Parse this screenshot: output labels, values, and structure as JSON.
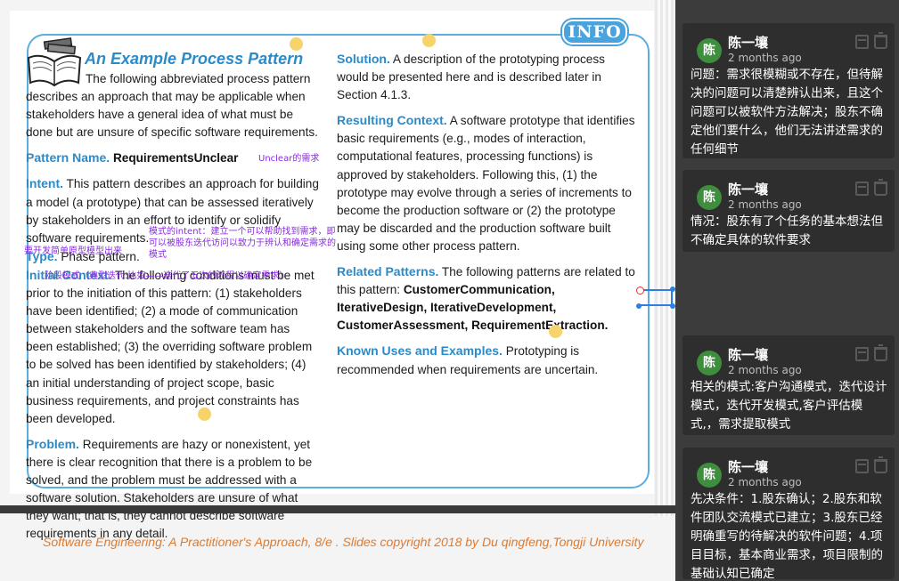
{
  "slide": {
    "info_badge": "INFO",
    "title": "An Example Process Pattern",
    "intro": "The following abbreviated process pattern describes an approach that may be applicable when stakeholders have a general idea of what must be done but are unsure of specific software requirements.",
    "pattern_name_label": "Pattern Name.",
    "pattern_name_value": "RequirementsUnclear",
    "intent_label": "Intent.",
    "intent_text": "This pattern describes an approach for building a model (a prototype) that can be assessed iteratively by stakeholders in an effort to identify or solidify software requirements.",
    "type_label": "Type.",
    "type_text": "Phase pattern.",
    "initial_context_label": "Initial Context.",
    "initial_context_text": "The following conditions must be met prior to the initiation of this pattern: (1) stakeholders have been identified; (2) a mode of communication between stakeholders and the software team has been established; (3) the overriding software problem to be solved has been identified by stakeholders; (4) an initial understanding of project scope, basic business requirements, and project constraints has been developed.",
    "problem_label": "Problem.",
    "problem_text": "Requirements are hazy or nonexistent, yet there is clear recognition that there is a problem to be solved, and the problem must be addressed with a software solution. Stakeholders are unsure of what they want; that is, they cannot describe software requirements in any detail.",
    "solution_label": "Solution.",
    "solution_text": "A description of the prototyping process would be presented here and is described later in Section 4.1.3.",
    "resulting_context_label": "Resulting Context.",
    "resulting_context_text": "A software prototype that identifies basic requirements (e.g., modes of interaction, computational features, processing functions) is approved by stakeholders. Following this, (1) the prototype may evolve through a series of increments to become the production software or (2) the prototype may be discarded and the production software built using some other process pattern.",
    "related_patterns_label": "Related Patterns.",
    "related_patterns_text": "The following patterns are related to this pattern:",
    "related_patterns_list": "CustomerCommunication, IterativeDesign, IterativeDevelopment, CustomerAssessment, RequirementExtraction.",
    "known_uses_label": "Known Uses and Examples.",
    "known_uses_text": "Prototyping is recommended when requirements are uncertain.",
    "notes": {
      "unclear": "Unclear的需求",
      "intent": "模式的intent：建立一个可以帮助找到需求，即可以被股东迭代访问以致力于辨认和确定需求的模式",
      "prototype": "要开发简单原型模型出来",
      "phase": "阶段模式（典型迭代:比如——迭代了五次的流程以确定需求）"
    },
    "footer": "Software Engineering: A Practitioner's Approach, 8/e . Slides copyright 2018 by  Du qingfeng,Tongji University"
  },
  "comments": [
    {
      "avatar": "陈",
      "author": "陈一壤",
      "time": "2 months ago",
      "text": "问题：需求很模糊或不存在，但待解决的问题可以清楚辨认出来，且这个问题可以被软件方法解决；股东不确定他们要什么，他们无法讲述需求的任何细节"
    },
    {
      "avatar": "陈",
      "author": "陈一壤",
      "time": "2 months ago",
      "text": "情况：股东有了个任务的基本想法但不确定具体的软件要求"
    },
    {
      "avatar": "陈",
      "author": "陈一壤",
      "time": "2 months ago",
      "text": "相关的模式:客户沟通模式，迭代设计模式，迭代开发模式,客户评估模式,，需求提取模式"
    },
    {
      "avatar": "陈",
      "author": "陈一壤",
      "time": "2 months ago",
      "text": "先决条件：1.股东确认；2.股东和软件团队交流模式已建立；3.股东已经明确重写的待解决的软件问题；4.项目目标，基本商业需求，项目限制的基础认知已确定"
    }
  ],
  "colors": {
    "heading": "#2a8bc8",
    "note": "#8a2be2",
    "footer": "#e07a2d",
    "avatar": "#3e8e3e",
    "highlight": "#f6d36b"
  },
  "icons": [
    "book-icon",
    "archive-icon",
    "trash-icon"
  ]
}
